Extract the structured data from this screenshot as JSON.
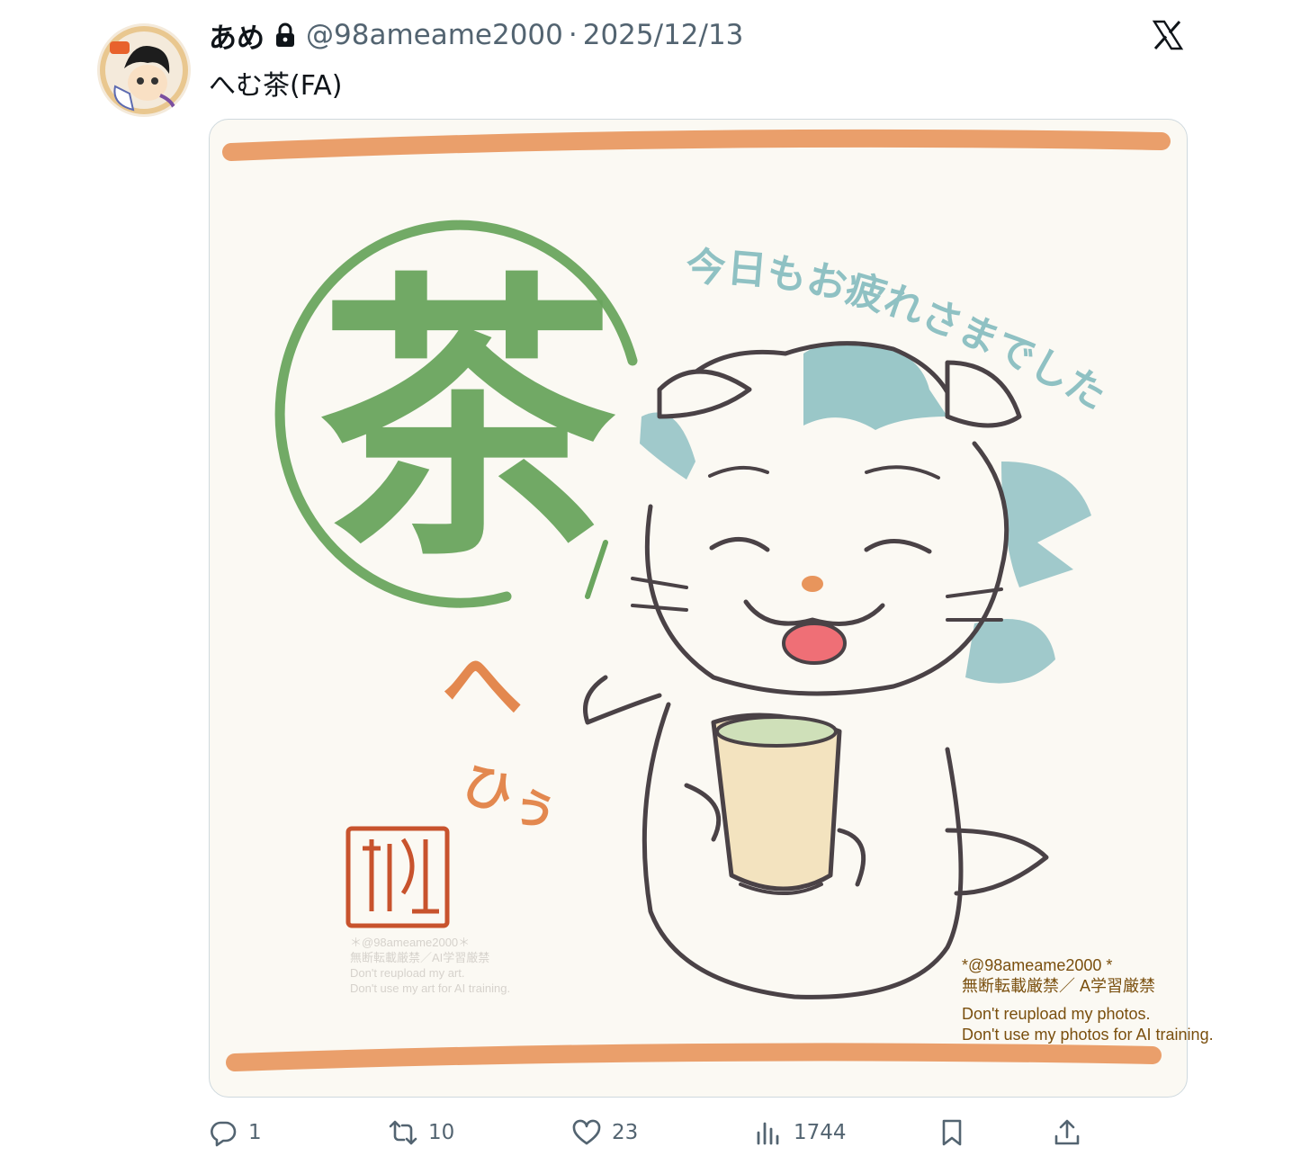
{
  "tweet": {
    "display_name": "あめ",
    "handle": "@98ameame2000",
    "separator": "·",
    "date": "2025/12/13",
    "text": "へむ茶(FA)"
  },
  "media": {
    "art_text": {
      "circle_kanji": "茶",
      "message": "今日もお疲れさまでした。",
      "sound_1": "へ",
      "sound_2": "ひぅ"
    },
    "watermark_left": [
      "＊@98ameame2000＊",
      "無断転載厳禁／AI学習厳禁",
      "Don't reupload my art.",
      "Don't use my art for AI training."
    ],
    "watermark_right": {
      "line1": "*@98ameame2000 *",
      "line2": "無断転載厳禁／ A学習厳禁",
      "line3": "Don't reupload my photos.",
      "line4": "Don't use my photos for AI training."
    },
    "colors": {
      "stripe": "#e8955c",
      "green": "#6aa55e",
      "blue": "#8fc1c3",
      "orange": "#e3884f",
      "seal": "#c8532d"
    }
  },
  "actions": {
    "reply": "1",
    "retweet": "10",
    "like": "23",
    "views": "1744"
  },
  "icons": [
    "lock-icon",
    "x-logo-icon",
    "reply-icon",
    "retweet-icon",
    "like-icon",
    "views-icon",
    "bookmark-icon",
    "share-icon"
  ]
}
